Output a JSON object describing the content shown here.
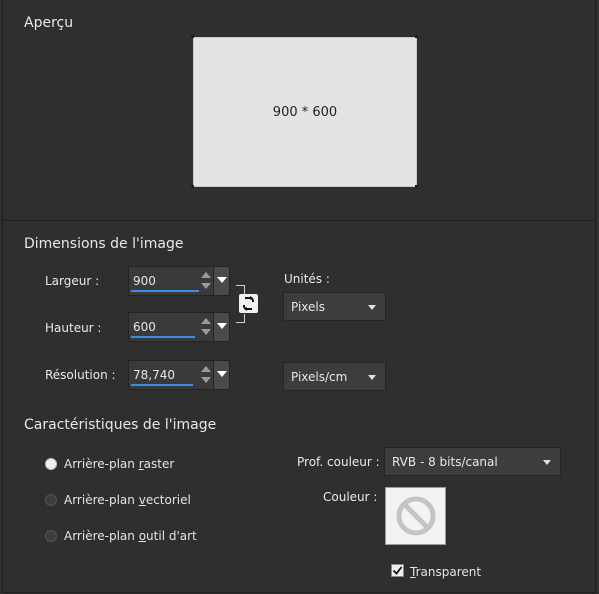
{
  "preview": {
    "title": "Aperçu",
    "size_text": "900 * 600"
  },
  "dimensions": {
    "title": "Dimensions de l'image",
    "width_label": "Largeur :",
    "width_value": "900",
    "height_label": "Hauteur :",
    "height_value": "600",
    "resolution_label": "Résolution :",
    "resolution_value": "78,740",
    "units_label": "Unités :",
    "units_value": "Pixels",
    "resolution_units_value": "Pixels/cm"
  },
  "characteristics": {
    "title": "Caractéristiques de l'image",
    "options": [
      {
        "pre": "Arrière-plan ",
        "key": "r",
        "post": "aster",
        "selected": true
      },
      {
        "pre": "Arrière-plan ",
        "key": "v",
        "post": "ectoriel",
        "selected": false
      },
      {
        "pre": "Arrière-plan ",
        "key": "o",
        "post": "util d'art",
        "selected": false
      }
    ],
    "color_depth_label": "Prof. couleur :",
    "color_depth_value": "RVB - 8 bits/canal",
    "color_label": "Couleur :",
    "transparent_key": "T",
    "transparent_rest": "ransparent",
    "transparent_checked": true
  },
  "icons": {
    "link": "link-chain-icon",
    "no_color": "prohibited-icon",
    "check": "checkmark-icon"
  }
}
